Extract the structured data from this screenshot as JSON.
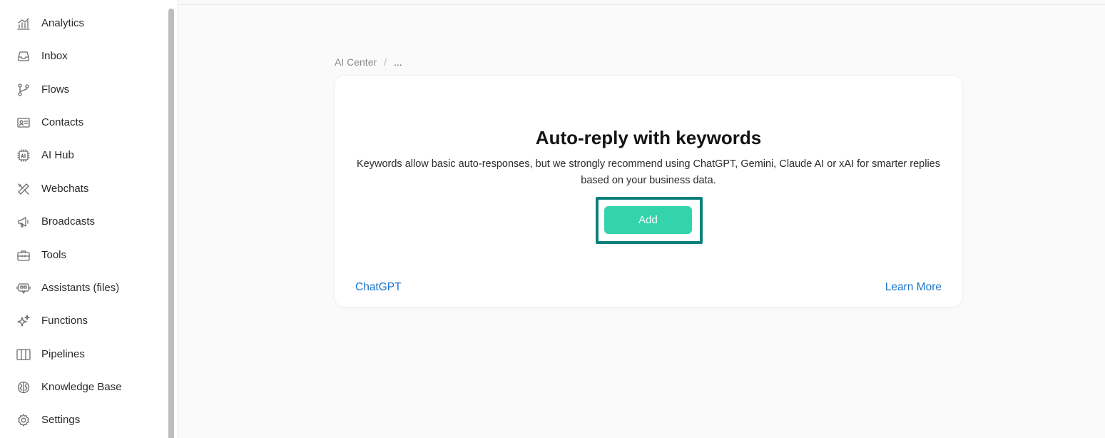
{
  "sidebar": {
    "items": [
      {
        "label": "Analytics",
        "icon": "analytics-icon"
      },
      {
        "label": "Inbox",
        "icon": "inbox-icon"
      },
      {
        "label": "Flows",
        "icon": "flows-icon"
      },
      {
        "label": "Contacts",
        "icon": "contacts-icon"
      },
      {
        "label": "AI Hub",
        "icon": "ai-chip-icon"
      },
      {
        "label": "Webchats",
        "icon": "tools-cross-icon"
      },
      {
        "label": "Broadcasts",
        "icon": "megaphone-icon"
      },
      {
        "label": "Tools",
        "icon": "toolbox-icon"
      },
      {
        "label": "Assistants (files)",
        "icon": "assistant-icon"
      },
      {
        "label": "Functions",
        "icon": "sparkles-icon"
      },
      {
        "label": "Pipelines",
        "icon": "pipelines-icon"
      },
      {
        "label": "Knowledge Base",
        "icon": "brain-icon"
      },
      {
        "label": "Settings",
        "icon": "gear-icon"
      }
    ]
  },
  "breadcrumb": {
    "root": "AI Center",
    "separator": "/",
    "current": "..."
  },
  "card": {
    "title": "Auto-reply with keywords",
    "description": "Keywords allow basic auto-responses, but we strongly recommend using ChatGPT, Gemini, Claude AI or xAI for smarter replies based on your business data.",
    "add_label": "Add",
    "left_link": "ChatGPT",
    "right_link": "Learn More"
  },
  "colors": {
    "accent": "#33d3ac",
    "focus_ring": "#0e7f7a",
    "link": "#1a73c9"
  }
}
